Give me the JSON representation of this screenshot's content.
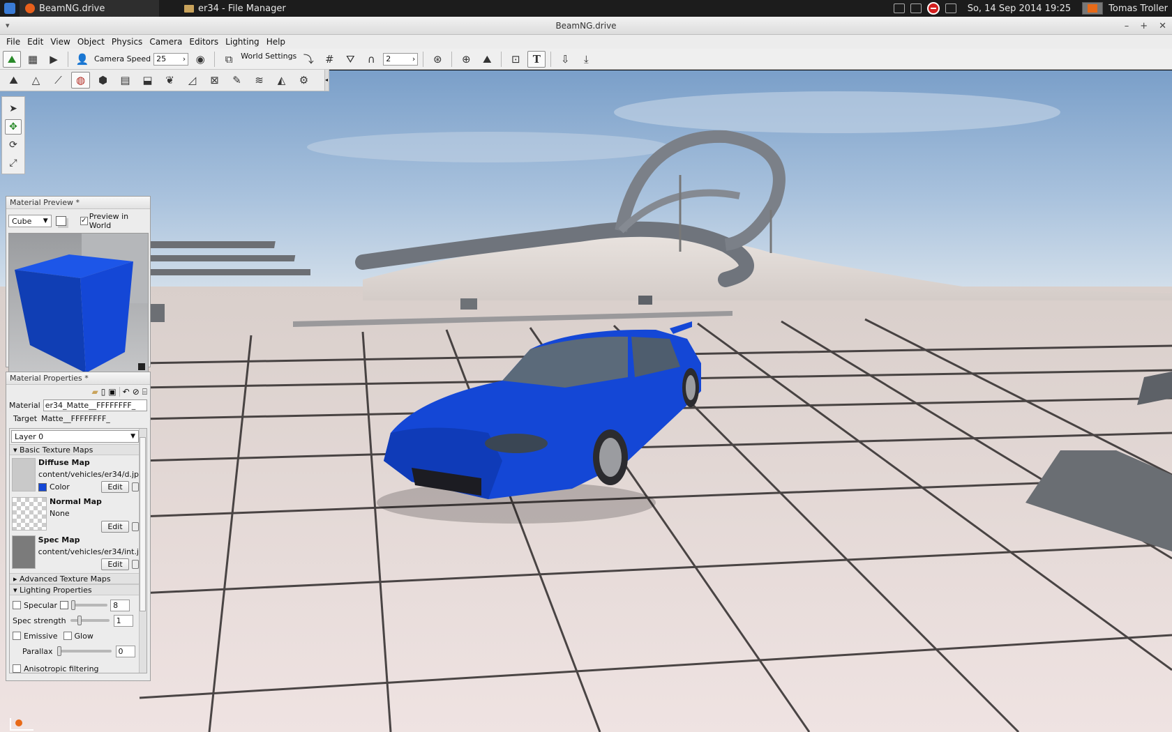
{
  "taskbar": {
    "tasks": [
      {
        "label": "BeamNG.drive",
        "icon": "beamng-app-icon"
      },
      {
        "label": "er34 - File Manager",
        "icon": "folder-icon"
      }
    ],
    "clock": "So, 14 Sep 2014 19:25",
    "user": "Tomas Troller"
  },
  "window": {
    "title": "BeamNG.drive"
  },
  "menubar": [
    "File",
    "Edit",
    "View",
    "Object",
    "Physics",
    "Camera",
    "Editors",
    "Lighting",
    "Help"
  ],
  "toolbar": {
    "camera_speed_label": "Camera Speed",
    "camera_speed_value": "25",
    "world_settings_label": "World Settings",
    "snap_value": "2"
  },
  "material_preview": {
    "title": "Material Preview *",
    "shape": "Cube",
    "preview_in_world_label": "Preview in World",
    "preview_in_world_checked": true,
    "cube_color": "#1447d6"
  },
  "material_properties": {
    "title": "Material Properties *",
    "material_label": "Material",
    "material_value": "er34_Matte__FFFFFFFF_",
    "target_label": "Target",
    "target_value": "Matte__FFFFFFFF_",
    "layer": "Layer 0",
    "sections": {
      "basic": "Basic Texture Maps",
      "advanced": "Advanced Texture Maps",
      "lighting": "Lighting Properties"
    },
    "maps": [
      {
        "name": "Diffuse Map",
        "path": "content/vehicles/er34/d.jp",
        "extra": "Color",
        "edit": "Edit",
        "swatch": "#1447d6"
      },
      {
        "name": "Normal Map",
        "path": "None",
        "edit": "Edit"
      },
      {
        "name": "Spec Map",
        "path": "content/vehicles/er34/int.j",
        "edit": "Edit"
      }
    ],
    "lighting": {
      "specular_label": "Specular",
      "specular_value": "8",
      "spec_strength_label": "Spec strength",
      "spec_strength_value": "1",
      "emissive_label": "Emissive",
      "glow_label": "Glow",
      "parallax_label": "Parallax",
      "parallax_value": "0",
      "anisotropic_label": "Anisotropic filtering"
    }
  },
  "scene": {
    "car_color": "#1447d6"
  }
}
